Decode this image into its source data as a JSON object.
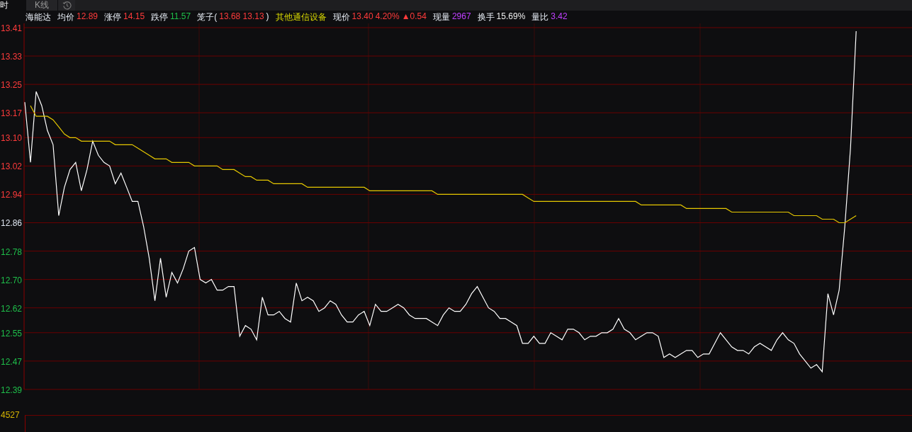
{
  "tabs": [
    {
      "label": "时",
      "selected": true
    },
    {
      "label": "K线",
      "selected": false
    }
  ],
  "quote_bar": [
    {
      "parts": [
        {
          "text": "海能达",
          "kind": "label"
        }
      ]
    },
    {
      "parts": [
        {
          "text": "均价",
          "kind": "label"
        },
        {
          "text": "12.89",
          "kind": "value",
          "color": "#ff3b3b"
        }
      ]
    },
    {
      "parts": [
        {
          "text": "涨停",
          "kind": "label"
        },
        {
          "text": "14.15",
          "kind": "value",
          "color": "#ff3b3b"
        }
      ]
    },
    {
      "parts": [
        {
          "text": "跌停",
          "kind": "label"
        },
        {
          "text": "11.57",
          "kind": "value",
          "color": "#1fbf4a"
        }
      ]
    },
    {
      "parts": [
        {
          "text": "笼子(",
          "kind": "label"
        },
        {
          "text": "13.68 13.13",
          "kind": "value",
          "color": "#ff3b3b"
        },
        {
          "text": ")",
          "kind": "label"
        }
      ]
    },
    {
      "parts": [
        {
          "text": "其他通信设备",
          "kind": "sector"
        }
      ]
    },
    {
      "parts": [
        {
          "text": "现价",
          "kind": "label"
        },
        {
          "text": "13.40",
          "kind": "value",
          "color": "#ff3b3b"
        },
        {
          "text": "4.20%",
          "kind": "value",
          "color": "#ff3b3b"
        },
        {
          "text": "▲0.54",
          "kind": "value",
          "color": "#ff3b3b"
        }
      ]
    },
    {
      "parts": [
        {
          "text": "现量",
          "kind": "label"
        },
        {
          "text": "2967",
          "kind": "value",
          "color": "#c040ff"
        }
      ]
    },
    {
      "parts": [
        {
          "text": "换手",
          "kind": "label"
        },
        {
          "text": "15.69%",
          "kind": "value",
          "color": "#eeeeee"
        }
      ]
    },
    {
      "parts": [
        {
          "text": "量比",
          "kind": "label"
        },
        {
          "text": "3.42",
          "kind": "value",
          "color": "#c040ff"
        }
      ]
    }
  ],
  "chart": {
    "chart_data": {
      "type": "line",
      "ylim": [
        12.39,
        13.41
      ],
      "grid": true,
      "yticks": [
        {
          "value": 13.41,
          "label": "13.41"
        },
        {
          "value": 13.33,
          "label": "13.33"
        },
        {
          "value": 13.25,
          "label": "13.25"
        },
        {
          "value": 13.17,
          "label": "13.17"
        },
        {
          "value": 13.1,
          "label": "13.10"
        },
        {
          "value": 13.02,
          "label": "13.02"
        },
        {
          "value": 12.94,
          "label": "12.94"
        },
        {
          "value": 12.86,
          "label": "12.86"
        },
        {
          "value": 12.78,
          "label": "12.78"
        },
        {
          "value": 12.7,
          "label": "12.70"
        },
        {
          "value": 12.62,
          "label": "12.62"
        },
        {
          "value": 12.55,
          "label": "12.55"
        },
        {
          "value": 12.47,
          "label": "12.47"
        },
        {
          "value": 12.39,
          "label": "12.39"
        }
      ],
      "series": [
        {
          "color": "#ffffff",
          "values": [
            13.2,
            13.03,
            13.23,
            13.19,
            13.12,
            13.08,
            12.88,
            12.96,
            13.01,
            13.03,
            12.95,
            13.01,
            13.09,
            13.05,
            13.03,
            13.02,
            12.97,
            13.0,
            12.96,
            12.92,
            12.92,
            12.85,
            12.76,
            12.64,
            12.76,
            12.65,
            12.72,
            12.69,
            12.73,
            12.78,
            12.79,
            12.7,
            12.69,
            12.7,
            12.67,
            12.67,
            12.68,
            12.68,
            12.54,
            12.57,
            12.56,
            12.53,
            12.65,
            12.6,
            12.6,
            12.61,
            12.59,
            12.58,
            12.69,
            12.64,
            12.65,
            12.64,
            12.61,
            12.62,
            12.64,
            12.63,
            12.6,
            12.58,
            12.58,
            12.6,
            12.61,
            12.57,
            12.63,
            12.61,
            12.61,
            12.62,
            12.63,
            12.62,
            12.6,
            12.59,
            12.59,
            12.59,
            12.58,
            12.57,
            12.6,
            12.62,
            12.61,
            12.61,
            12.63,
            12.66,
            12.68,
            12.65,
            12.62,
            12.61,
            12.59,
            12.59,
            12.58,
            12.57,
            12.52,
            12.52,
            12.54,
            12.52,
            12.52,
            12.55,
            12.54,
            12.53,
            12.56,
            12.56,
            12.55,
            12.53,
            12.54,
            12.54,
            12.55,
            12.55,
            12.56,
            12.59,
            12.56,
            12.55,
            12.53,
            12.54,
            12.55,
            12.55,
            12.54,
            12.48,
            12.49,
            12.48,
            12.49,
            12.5,
            12.5,
            12.48,
            12.49,
            12.49,
            12.52,
            12.55,
            12.53,
            12.51,
            12.5,
            12.5,
            12.49,
            12.51,
            12.52,
            12.51,
            12.5,
            12.53,
            12.55,
            12.53,
            12.52,
            12.49,
            12.47,
            12.45,
            12.46,
            12.44,
            12.66,
            12.6,
            12.67,
            12.85,
            13.07,
            13.4
          ]
        },
        {
          "color": "#e6c800",
          "values": [
            null,
            13.19,
            13.16,
            13.16,
            13.16,
            13.15,
            13.13,
            13.11,
            13.1,
            13.1,
            13.09,
            13.09,
            13.09,
            13.09,
            13.09,
            13.09,
            13.08,
            13.08,
            13.08,
            13.08,
            13.07,
            13.06,
            13.05,
            13.04,
            13.04,
            13.04,
            13.03,
            13.03,
            13.03,
            13.03,
            13.02,
            13.02,
            13.02,
            13.02,
            13.02,
            13.01,
            13.01,
            13.01,
            13.0,
            12.99,
            12.99,
            12.98,
            12.98,
            12.98,
            12.97,
            12.97,
            12.97,
            12.97,
            12.97,
            12.97,
            12.96,
            12.96,
            12.96,
            12.96,
            12.96,
            12.96,
            12.96,
            12.96,
            12.96,
            12.96,
            12.96,
            12.95,
            12.95,
            12.95,
            12.95,
            12.95,
            12.95,
            12.95,
            12.95,
            12.95,
            12.95,
            12.95,
            12.95,
            12.94,
            12.94,
            12.94,
            12.94,
            12.94,
            12.94,
            12.94,
            12.94,
            12.94,
            12.94,
            12.94,
            12.94,
            12.94,
            12.94,
            12.94,
            12.94,
            12.93,
            12.92,
            12.92,
            12.92,
            12.92,
            12.92,
            12.92,
            12.92,
            12.92,
            12.92,
            12.92,
            12.92,
            12.92,
            12.92,
            12.92,
            12.92,
            12.92,
            12.92,
            12.92,
            12.92,
            12.91,
            12.91,
            12.91,
            12.91,
            12.91,
            12.91,
            12.91,
            12.91,
            12.9,
            12.9,
            12.9,
            12.9,
            12.9,
            12.9,
            12.9,
            12.9,
            12.89,
            12.89,
            12.89,
            12.89,
            12.89,
            12.89,
            12.89,
            12.89,
            12.89,
            12.89,
            12.89,
            12.88,
            12.88,
            12.88,
            12.88,
            12.88,
            12.87,
            12.87,
            12.87,
            12.86,
            12.86,
            12.87,
            12.88
          ]
        }
      ]
    },
    "price_axis": [
      {
        "color": "#ff3b3b"
      },
      {
        "color": "#ff3b3b"
      },
      {
        "color": "#ff3b3b"
      },
      {
        "color": "#ff3b3b"
      },
      {
        "color": "#ff3b3b"
      },
      {
        "color": "#ff3b3b"
      },
      {
        "color": "#ff3b3b"
      },
      {
        "color": "#dfe6f0"
      },
      {
        "color": "#1fbf4a"
      },
      {
        "color": "#1fbf4a"
      },
      {
        "color": "#1fbf4a"
      },
      {
        "color": "#1fbf4a"
      },
      {
        "color": "#1fbf4a"
      },
      {
        "color": "#1fbf4a"
      }
    ],
    "volume_axis_label": "4527"
  }
}
